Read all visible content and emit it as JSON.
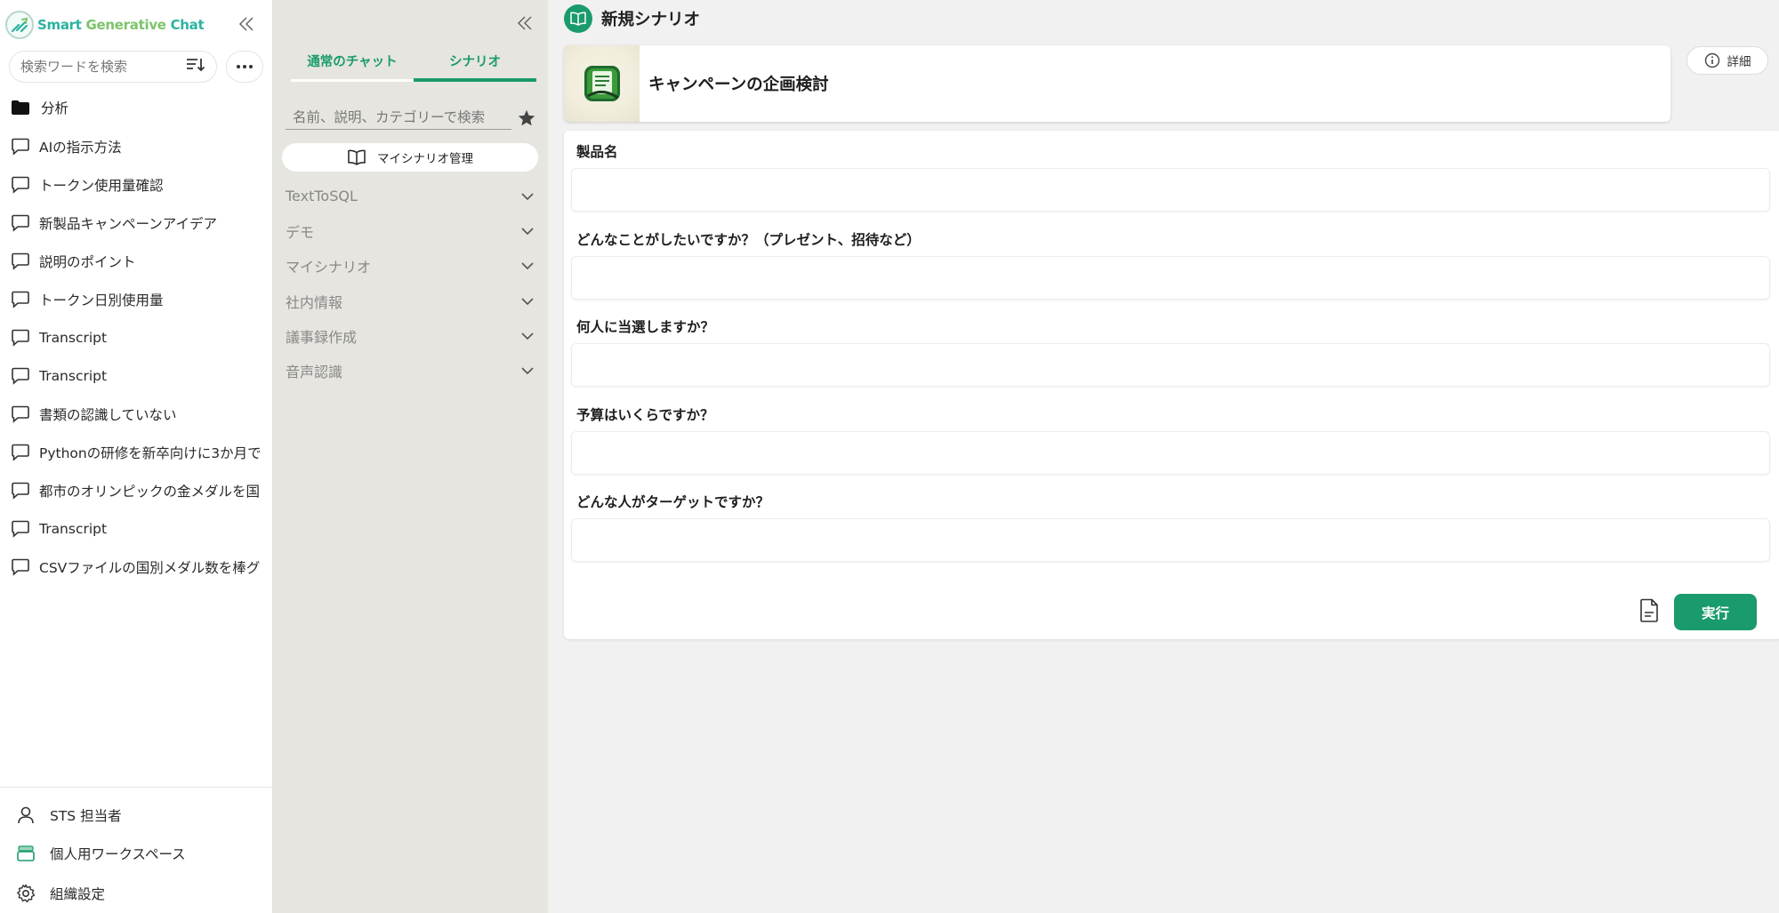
{
  "app": {
    "logo_text_a": "Smart ",
    "logo_text_b": "Generative",
    "logo_text_c": " Chat"
  },
  "sidebar": {
    "search_placeholder": "検索ワードを検索",
    "folder": "分析",
    "chats": [
      "AIの指示方法",
      "トークン使用量確認",
      "新製品キャンペーンアイデア",
      "説明のポイント",
      "トークン日別使用量",
      "Transcript",
      "Transcript",
      "書類の認識していない",
      "Pythonの研修を新卒向けに3か月で",
      "都市のオリンピックの金メダルを国",
      "Transcript",
      "CSVファイルの国別メダル数を棒グ"
    ],
    "footer": {
      "user": "STS 担当者",
      "workspace": "個人用ワークスペース",
      "org_settings": "組織設定"
    }
  },
  "scenario_panel": {
    "tabs": [
      "通常のチャット",
      "シナリオ"
    ],
    "active_tab": 1,
    "search_placeholder": "名前、説明、カテゴリーで検索",
    "my_scenarios_button": "マイシナリオ管理",
    "categories": [
      "TextToSQL",
      "デモ",
      "マイシナリオ",
      "社内情報",
      "議事録作成",
      "音声認識"
    ]
  },
  "main": {
    "page_title": "新規シナリオ",
    "scenario_name": "キャンペーンの企画検討",
    "detail_button": "詳細",
    "fields": [
      {
        "label": "製品名",
        "value": ""
      },
      {
        "label": "どんなことがしたいですか？（プレゼント、招待など）",
        "value": ""
      },
      {
        "label": "何人に当選しますか？",
        "value": ""
      },
      {
        "label": "予算はいくらですか？",
        "value": ""
      },
      {
        "label": "どんな人がターゲットですか？",
        "value": ""
      }
    ],
    "run_button": "実行"
  },
  "colors": {
    "accent": "#1a9b6c",
    "panel_bg": "#e6e5df",
    "main_bg": "#f1f1f1"
  },
  "icons": {
    "chat": "speech-bubble-icon",
    "folder": "folder-icon",
    "collapse": "double-chevron-left-icon",
    "sort": "sort-icon",
    "more": "ellipsis-icon",
    "star": "star-icon",
    "book": "book-icon",
    "chevron": "chevron-down-icon",
    "info": "info-icon",
    "document": "document-icon",
    "user": "user-icon",
    "workspace": "layers-icon",
    "settings": "gear-icon"
  }
}
